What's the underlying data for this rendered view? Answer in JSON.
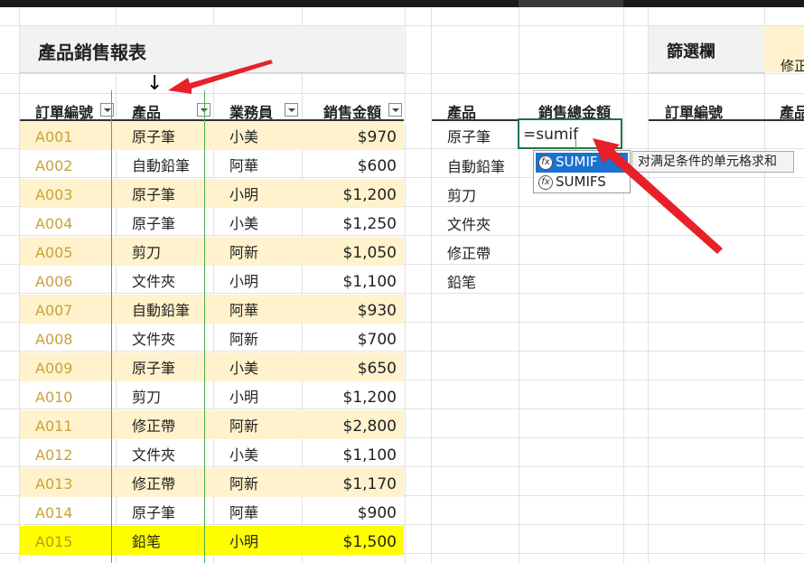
{
  "report": {
    "title": "產品銷售報表"
  },
  "filter": {
    "title": "篩選欄",
    "partial_value": "修正"
  },
  "table": {
    "headers": {
      "id": "訂單編號",
      "product": "產品",
      "rep": "業務員",
      "amount": "銷售金額"
    },
    "rows": [
      {
        "id": "A001",
        "product": "原子筆",
        "rep": "小美",
        "amount": "$970"
      },
      {
        "id": "A002",
        "product": "自動鉛筆",
        "rep": "阿華",
        "amount": "$600"
      },
      {
        "id": "A003",
        "product": "原子筆",
        "rep": "小明",
        "amount": "$1,200"
      },
      {
        "id": "A004",
        "product": "原子筆",
        "rep": "小美",
        "amount": "$1,250"
      },
      {
        "id": "A005",
        "product": "剪刀",
        "rep": "阿新",
        "amount": "$1,050"
      },
      {
        "id": "A006",
        "product": "文件夾",
        "rep": "小明",
        "amount": "$1,100"
      },
      {
        "id": "A007",
        "product": "自動鉛筆",
        "rep": "阿華",
        "amount": "$930"
      },
      {
        "id": "A008",
        "product": "文件夾",
        "rep": "阿新",
        "amount": "$700"
      },
      {
        "id": "A009",
        "product": "原子筆",
        "rep": "小美",
        "amount": "$650"
      },
      {
        "id": "A010",
        "product": "剪刀",
        "rep": "小明",
        "amount": "$1,200"
      },
      {
        "id": "A011",
        "product": "修正帶",
        "rep": "阿新",
        "amount": "$2,800"
      },
      {
        "id": "A012",
        "product": "文件夾",
        "rep": "小美",
        "amount": "$1,100"
      },
      {
        "id": "A013",
        "product": "修正帶",
        "rep": "阿新",
        "amount": "$1,170"
      },
      {
        "id": "A014",
        "product": "原子筆",
        "rep": "阿華",
        "amount": "$900"
      },
      {
        "id": "A015",
        "product": "鉛笔",
        "rep": "小明",
        "amount": "$1,500"
      }
    ]
  },
  "summary": {
    "headers": {
      "product": "產品",
      "total": "銷售總金額"
    },
    "products": [
      "原子筆",
      "自動鉛筆",
      "剪刀",
      "文件夾",
      "修正帶",
      "鉛笔"
    ],
    "editing_formula": "=sumif"
  },
  "filter_table": {
    "headers": {
      "id": "訂單編號",
      "product": "產品"
    }
  },
  "autocomplete": {
    "items": [
      {
        "label": "SUMIF",
        "selected": true
      },
      {
        "label": "SUMIFS",
        "selected": false
      }
    ],
    "icon": "fx-function-icon",
    "tooltip": "对满足条件的单元格求和"
  },
  "annotations": {
    "down_arrow": "↓",
    "arrow_color": "#e8202a"
  },
  "colors": {
    "band": "#fff2cc",
    "highlight": "#ffff00",
    "select": "#1b72d0",
    "edit_border": "#217346"
  }
}
